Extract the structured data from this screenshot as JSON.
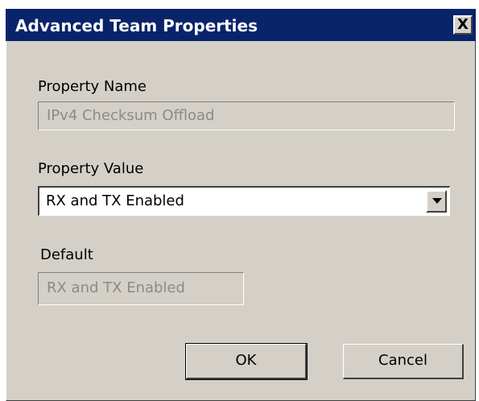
{
  "dialog": {
    "title": "Advanced Team Properties",
    "close_label": "X"
  },
  "property_name": {
    "label": "Property Name",
    "value": "IPv4 Checksum Offload"
  },
  "property_value": {
    "label": "Property Value",
    "selected": "RX and TX Enabled"
  },
  "default": {
    "label": "Default",
    "value": "RX and TX Enabled"
  },
  "buttons": {
    "ok": "OK",
    "cancel": "Cancel"
  },
  "colors": {
    "titlebar": "#0a246a",
    "dialog_bg": "#d4d0c8"
  }
}
